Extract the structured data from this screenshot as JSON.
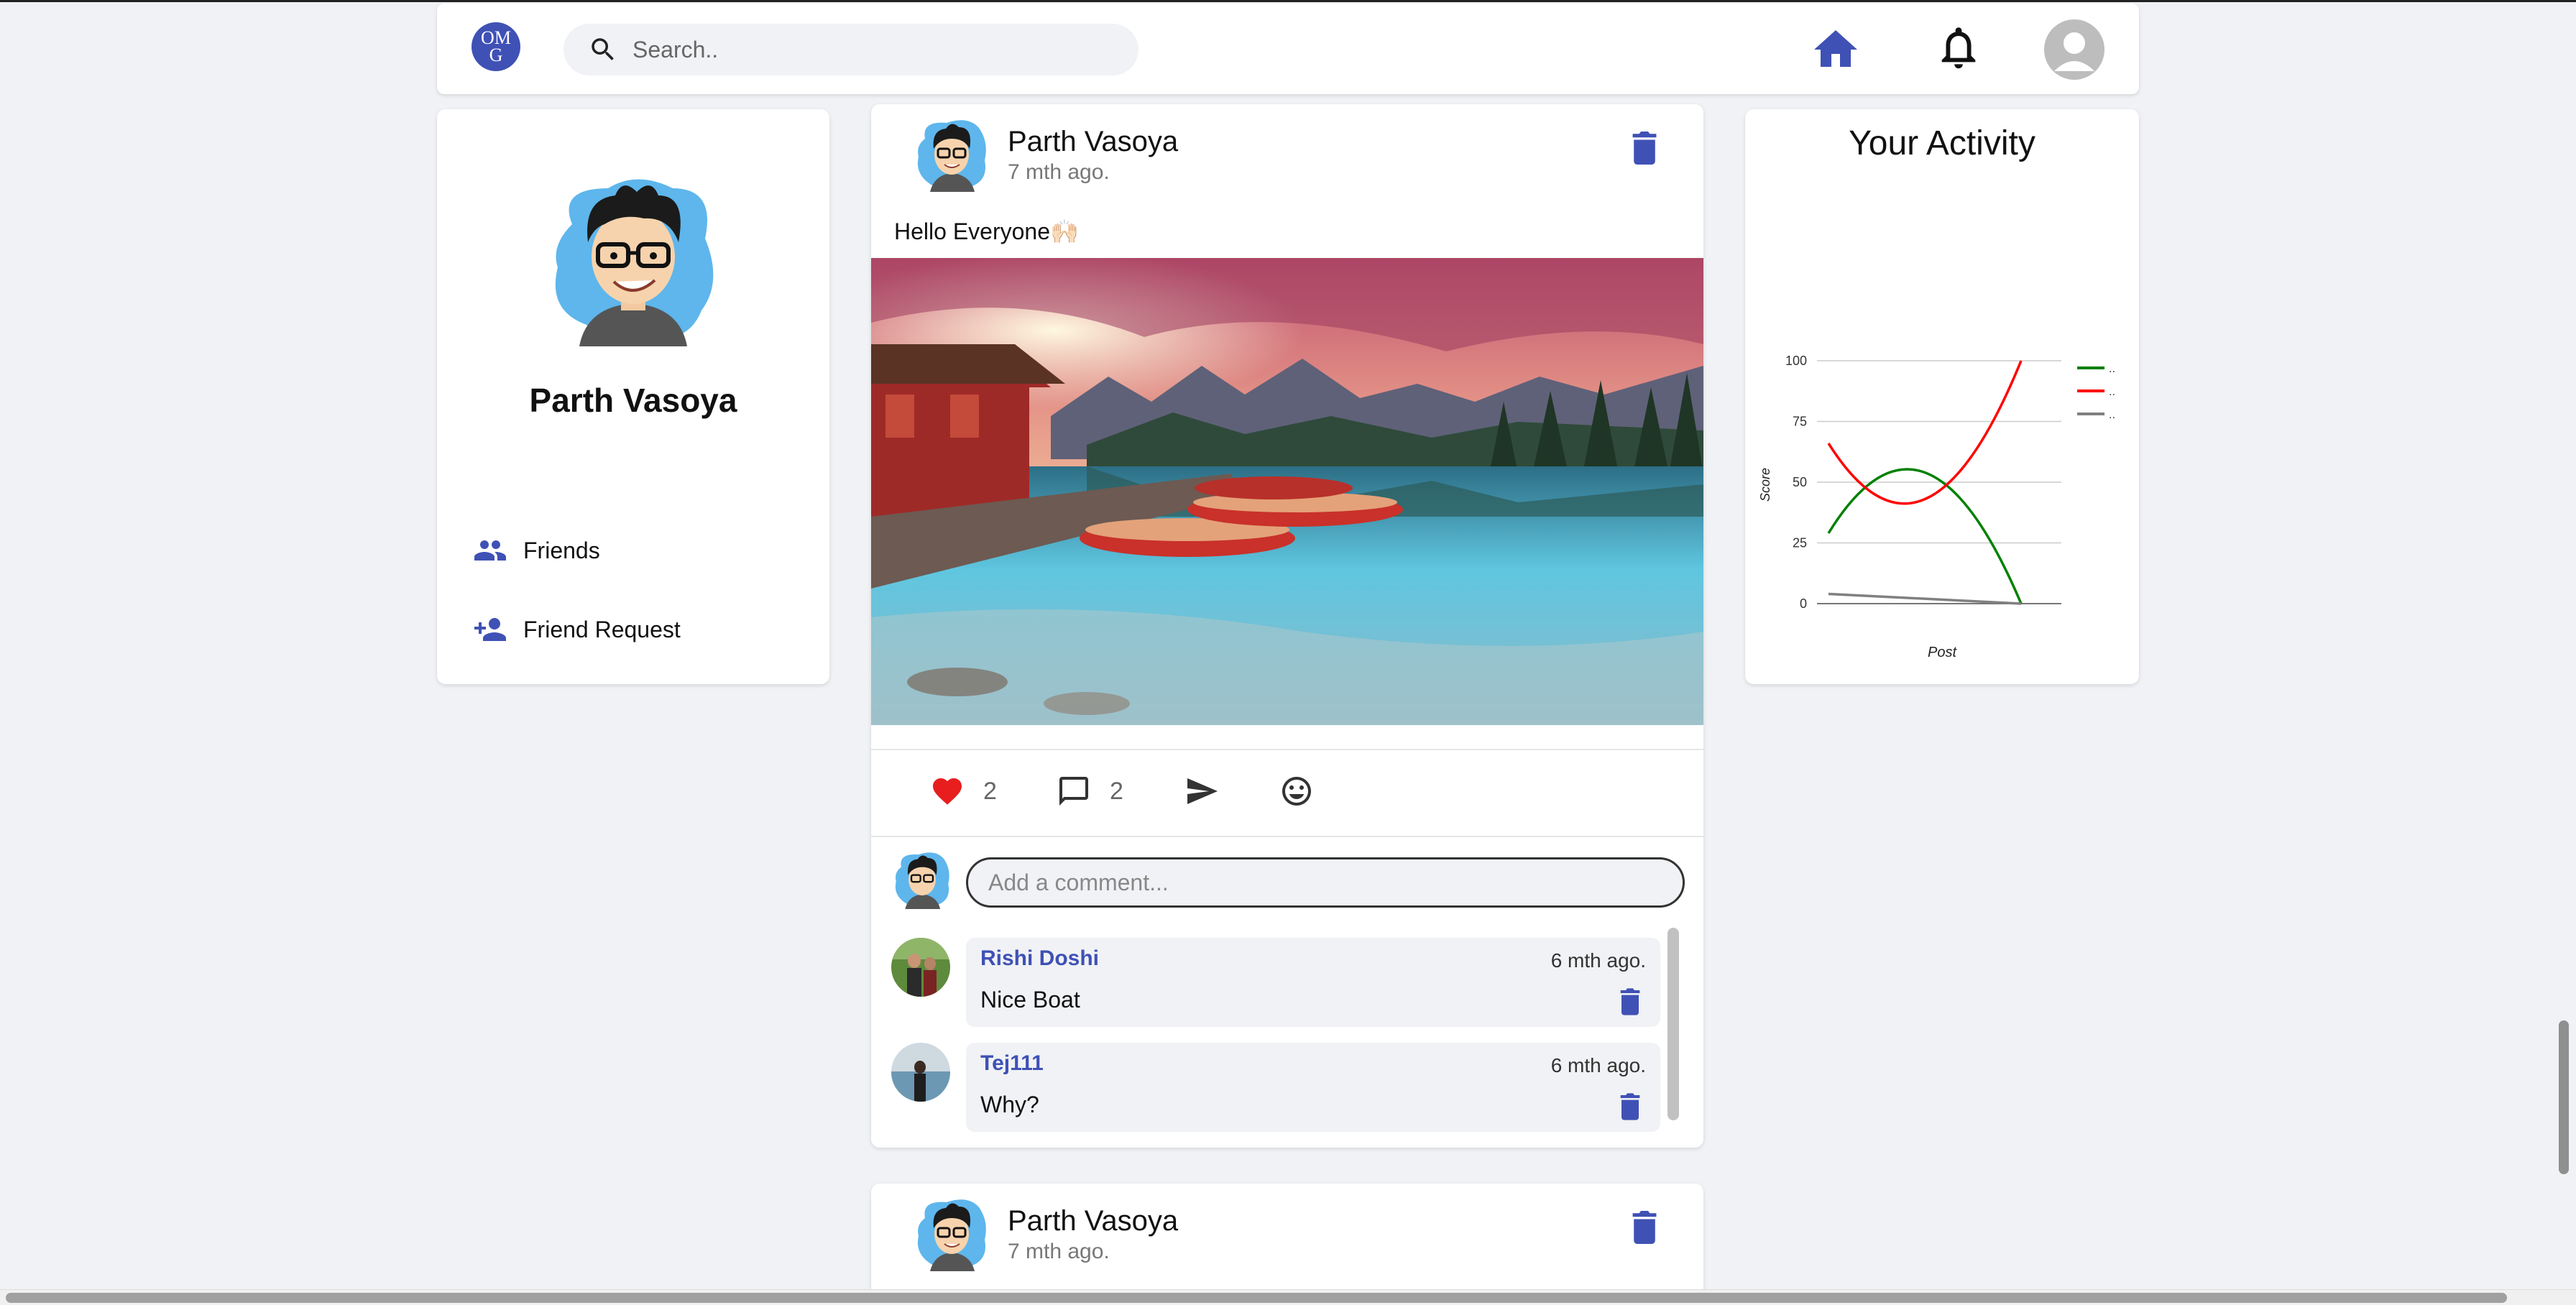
{
  "header": {
    "logo_line1": "OM",
    "logo_line2": "G",
    "search_placeholder": "Search..",
    "icons": [
      "search-icon",
      "home-icon",
      "bell-icon",
      "account-icon"
    ],
    "accent_color": "#3f51b5"
  },
  "sidebar": {
    "name": "Parth Vasoya",
    "items": [
      {
        "label": "Friends",
        "icon": "people-icon"
      },
      {
        "label": "Friend Request",
        "icon": "person-add-icon"
      }
    ]
  },
  "post": {
    "author": "Parth Vasoya",
    "time": "7 mth ago.",
    "text": "Hello Everyone🙌🏻",
    "likes": "2",
    "comments_count": "2",
    "comment_placeholder": "Add a comment...",
    "comments": [
      {
        "name": "Rishi Doshi",
        "time": "6 mth ago.",
        "text": "Nice Boat"
      },
      {
        "name": "Tej111",
        "time": "6 mth ago.",
        "text": "Why?"
      }
    ]
  },
  "post2": {
    "author": "Parth Vasoya",
    "time": "7 mth ago."
  },
  "activity": {
    "title": "Your Activity"
  },
  "chart_data": {
    "type": "line",
    "xlabel": "Post",
    "ylabel": "Score",
    "ylim": [
      0,
      100
    ],
    "yticks": [
      "0",
      "25",
      "50",
      "75",
      "100"
    ],
    "legend_placement": "right",
    "grid": true,
    "series": [
      {
        "color": "#008000",
        "values": [
          29,
          54,
          0
        ]
      },
      {
        "color": "#ff0000",
        "values": [
          66,
          43,
          100
        ]
      },
      {
        "color": "#808080",
        "values": [
          4,
          2,
          0
        ]
      }
    ],
    "legend_labels": [
      "..",
      "..",
      ".."
    ]
  }
}
